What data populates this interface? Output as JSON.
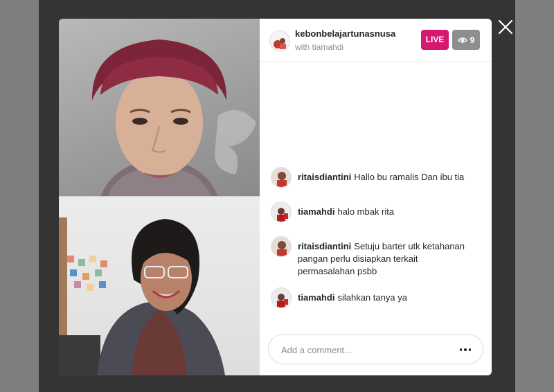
{
  "header": {
    "host_username": "kebonbelajartunasnusa",
    "with_text": "with tiamahdi",
    "live_label": "LIVE",
    "viewer_count": "9"
  },
  "comments": [
    {
      "username": "ritaisdiantini",
      "text": "Hallo bu ramalis Dan ibu tia"
    },
    {
      "username": "tiamahdi",
      "text": "halo mbak rita"
    },
    {
      "username": "ritaisdiantini",
      "text": "Setuju barter utk ketahanan pangan perlu disiapkan terkait permasalahan psbb"
    },
    {
      "username": "tiamahdi",
      "text": "silahkan tanya ya"
    }
  ],
  "comment_input": {
    "placeholder": "Add a comment..."
  },
  "icons": {
    "close": "close-icon",
    "eye": "eye-icon",
    "more": "more-options-icon"
  },
  "colors": {
    "live": "#d6186f",
    "viewers": "#8e8e8e",
    "text": "#262626",
    "muted": "#8e8e8e"
  }
}
